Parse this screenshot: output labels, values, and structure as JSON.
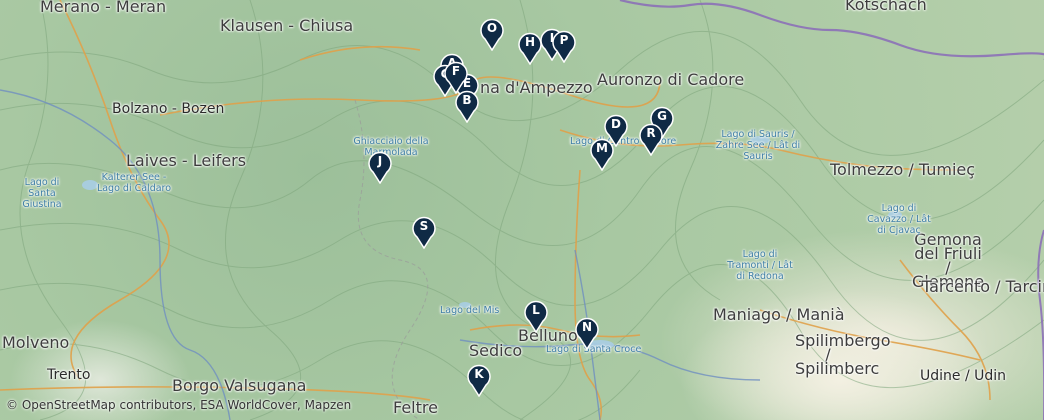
{
  "places": [
    {
      "id": "merano",
      "text": "Merano - Meran",
      "class": "mid"
    },
    {
      "id": "klausen",
      "text": "Klausen - Chiusa",
      "class": "mid"
    },
    {
      "id": "rotschen",
      "text": "Kötschach",
      "class": "small"
    },
    {
      "id": "bolzano",
      "text": "Bolzano - Bozen",
      "class": "big"
    },
    {
      "id": "laives",
      "text": "Laives - Leifers",
      "class": "mid"
    },
    {
      "id": "cortina",
      "text": "na d'Ampezzo",
      "class": "mid"
    },
    {
      "id": "auronzo",
      "text": "Auronzo di Cadore",
      "class": "mid"
    },
    {
      "id": "tolmezzo",
      "text": "Tolmezzo / Tumieç",
      "class": "mid"
    },
    {
      "id": "gemona",
      "text": "Gemona del Friuli / Glemone",
      "class": "mid"
    },
    {
      "id": "tarcento",
      "text": "Tarcento / Tarcint",
      "class": "mid"
    },
    {
      "id": "maniago",
      "text": "Maniago / Manià",
      "class": "mid"
    },
    {
      "id": "spilimbergo",
      "text": "Spilimbergo / Spilimberc",
      "class": "mid"
    },
    {
      "id": "udine",
      "text": "Udine / Udin",
      "class": "big"
    },
    {
      "id": "trento",
      "text": "Trento",
      "class": "big"
    },
    {
      "id": "borgo",
      "text": "Borgo Valsugana",
      "class": "mid"
    },
    {
      "id": "molveno",
      "text": "Molveno",
      "class": "small"
    },
    {
      "id": "sedico",
      "text": "Sedico",
      "class": "mid"
    },
    {
      "id": "belluno",
      "text": "Belluno",
      "class": "mid"
    },
    {
      "id": "feltre",
      "text": "Feltre",
      "class": "mid"
    }
  ],
  "water_labels": [
    {
      "id": "santa-giustina",
      "text": "Lago di Santa Giustina"
    },
    {
      "id": "kalterer",
      "text": "Kalterer See - Lago di Caldaro"
    },
    {
      "id": "ghiacciaio",
      "text": "Ghiacciaio della Marmolada"
    },
    {
      "id": "centro-cadore",
      "text": "Lago di Centro Cadore"
    },
    {
      "id": "sauris",
      "text": "Lago di Sauris / Zahre See / Lât di Sauris"
    },
    {
      "id": "cavazzo",
      "text": "Lago di Cavazzo / Lât di Cjavaç"
    },
    {
      "id": "tramonti",
      "text": "Lago di Tramonti / Lât di Redona"
    },
    {
      "id": "mis",
      "text": "Lago del Mis"
    },
    {
      "id": "santa-croce",
      "text": "Lago di Santa Croce"
    }
  ],
  "markers": [
    {
      "letter": "O"
    },
    {
      "letter": "H"
    },
    {
      "letter": "I"
    },
    {
      "letter": "P"
    },
    {
      "letter": "A"
    },
    {
      "letter": "C"
    },
    {
      "letter": "E"
    },
    {
      "letter": "F"
    },
    {
      "letter": "B"
    },
    {
      "letter": "D"
    },
    {
      "letter": "G"
    },
    {
      "letter": "R"
    },
    {
      "letter": "M"
    },
    {
      "letter": "J"
    },
    {
      "letter": "S"
    },
    {
      "letter": "L"
    },
    {
      "letter": "N"
    },
    {
      "letter": "K"
    }
  ],
  "marker_color": "#0f2a45",
  "attribution": "© OpenStreetMap contributors, ESA WorldCover, Mapzen"
}
